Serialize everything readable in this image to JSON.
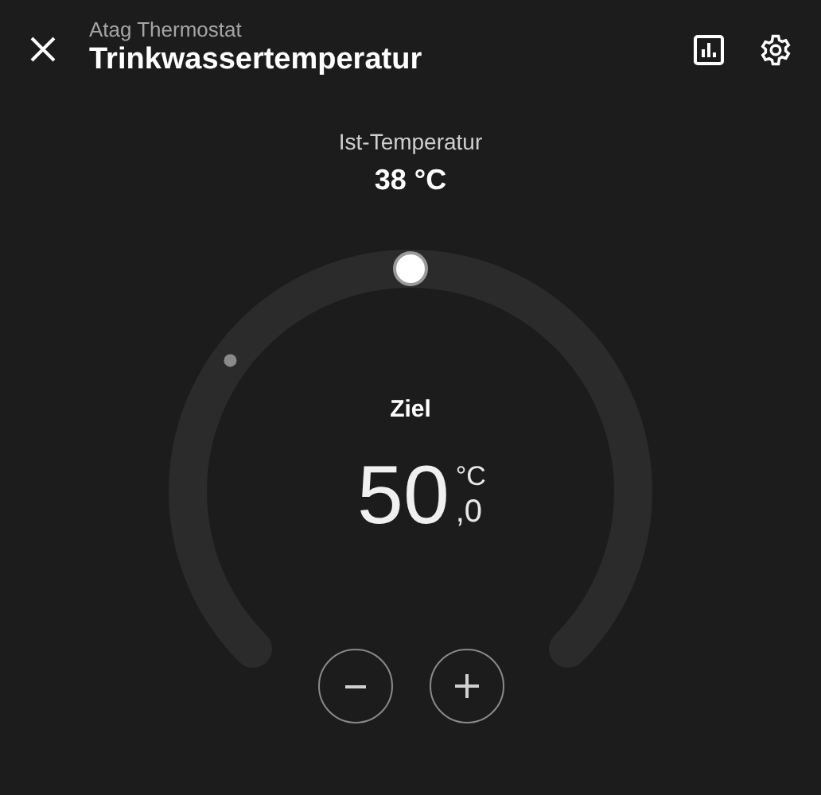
{
  "header": {
    "subtitle": "Atag Thermostat",
    "title": "Trinkwassertemperatur"
  },
  "current": {
    "label": "Ist-Temperatur",
    "value": "38 °C"
  },
  "target": {
    "label": "Ziel",
    "integer": "50",
    "decimal": ",0",
    "unit": "°C"
  },
  "buttons": [
    {
      "kind": "minus"
    },
    {
      "kind": "plus"
    }
  ]
}
